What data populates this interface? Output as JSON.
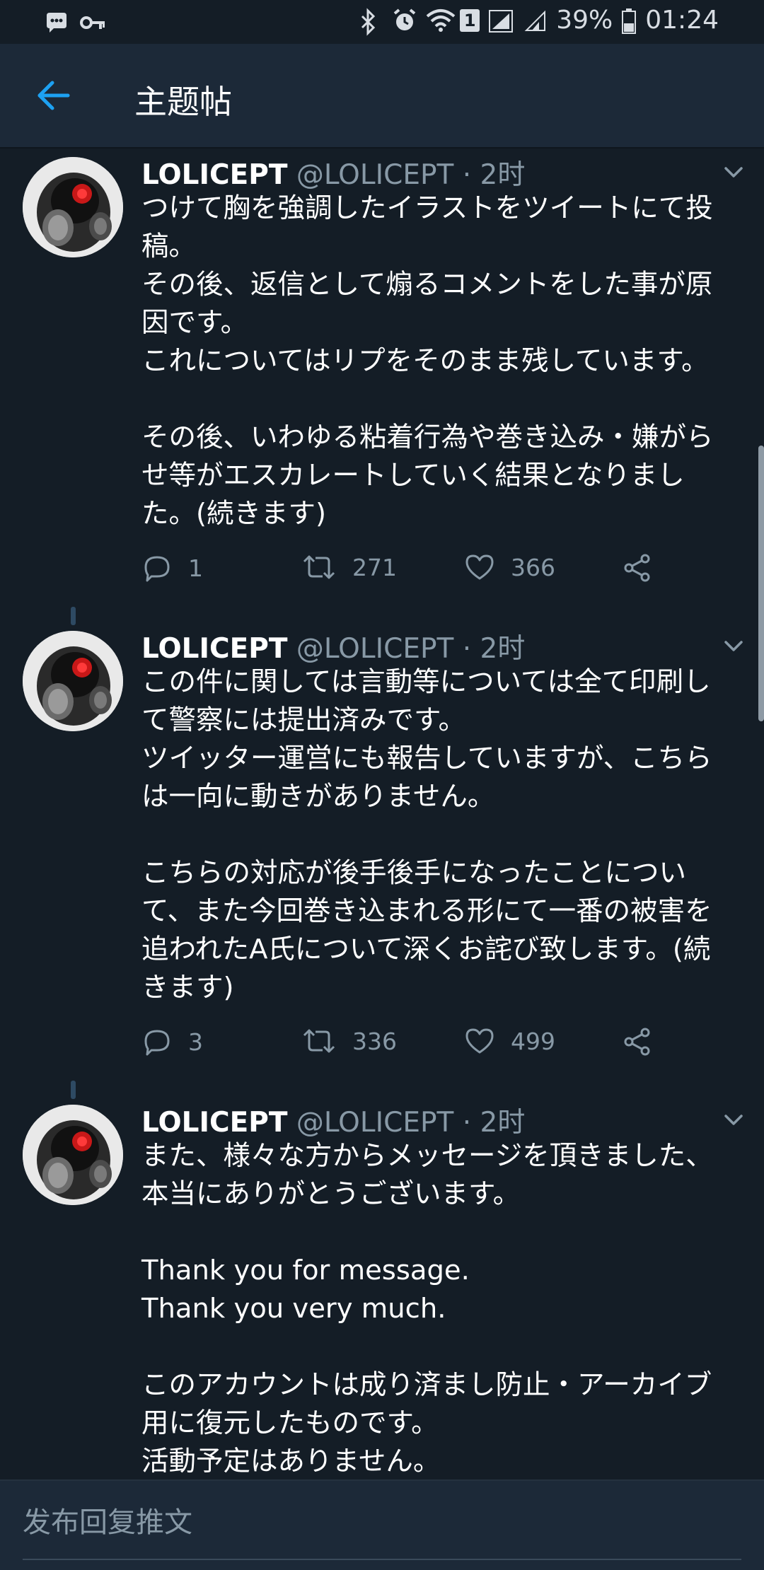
{
  "status_bar": {
    "battery": "39%",
    "time": "01:24",
    "sim_badge": "1"
  },
  "app_bar": {
    "title": "主题帖"
  },
  "tweets": [
    {
      "author_name": "LOLICEPT",
      "author_handle": "@LOLICEPT",
      "time": "· 2时",
      "text": "つけて胸を強調したイラストをツイートにて投\n稿。\nその後、返信として煽るコメントをした事が原\n因です。\nこれについてはリプをそのまま残しています。\n\nその後、いわゆる粘着行為や巻き込み・嫌がら\nせ等がエスカレートしていく結果となりまし\nた。(続きます)",
      "replies": "1",
      "retweets": "271",
      "likes": "366"
    },
    {
      "author_name": "LOLICEPT",
      "author_handle": "@LOLICEPT",
      "time": "· 2时",
      "text": "この件に関しては言動等については全て印刷し\nて警察には提出済みです。\nツイッター運営にも報告していますが、こちら\nは一向に動きがありません。\n\nこちらの対応が後手後手になったことについ\nて、また今回巻き込まれる形にて一番の被害を\n追われたA氏について深くお詫び致します。(続\nきます)",
      "replies": "3",
      "retweets": "336",
      "likes": "499"
    },
    {
      "author_name": "LOLICEPT",
      "author_handle": "@LOLICEPT",
      "time": "· 2时",
      "text": "また、様々な方からメッセージを頂きました、\n本当にありがとうございます。\n\nThank you for message.\nThank you very much.\n\nこのアカウントは成り済まし防止・アーカイブ\n用に復元したものです。\n活動予定はありません。",
      "replies": "",
      "retweets": "",
      "likes": ""
    }
  ],
  "compose": {
    "placeholder": "发布回复推文"
  },
  "colors": {
    "background": "#141d26",
    "bar": "#1c2938",
    "accent": "#1da1f2",
    "secondary_text": "#8899a6"
  },
  "icons": [
    "chat-icon",
    "key-icon",
    "bluetooth-icon",
    "alarm-icon",
    "wifi-icon",
    "signal-icon",
    "battery-icon",
    "back-arrow-icon",
    "chevron-down-icon",
    "reply-icon",
    "retweet-icon",
    "like-icon",
    "share-icon"
  ]
}
